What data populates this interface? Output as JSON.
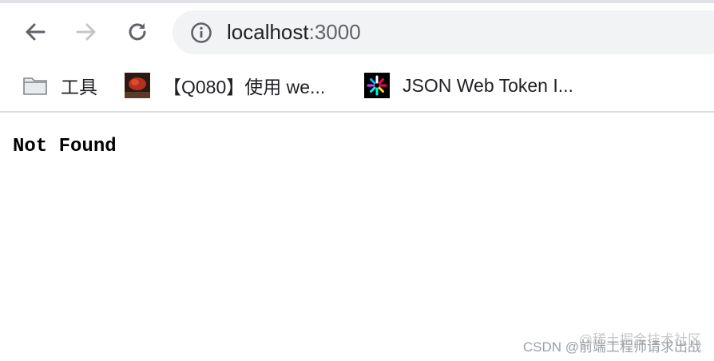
{
  "browser": {
    "nav": {
      "back_icon": "arrow-left-icon",
      "forward_icon": "arrow-right-icon",
      "reload_icon": "reload-icon"
    },
    "omnibox": {
      "info_icon": "info-icon",
      "host": "localhost",
      "port": ":3000"
    },
    "bookmarks": [
      {
        "icon": "folder-icon",
        "label": "工具"
      },
      {
        "icon": "red-thumbnail-icon",
        "label": "【Q080】使用 we..."
      },
      {
        "icon": "jwt-logo-icon",
        "label": "JSON Web Token I..."
      }
    ]
  },
  "page": {
    "body_text": "Not Found"
  },
  "watermark": {
    "line1": "@稀土掘金技术社区",
    "line2": "CSDN @前端工程师请求出战"
  },
  "colors": {
    "omnibox_bg": "#f1f3f4",
    "text": "#202124",
    "muted": "#5f6368",
    "divider": "#dadce0"
  }
}
